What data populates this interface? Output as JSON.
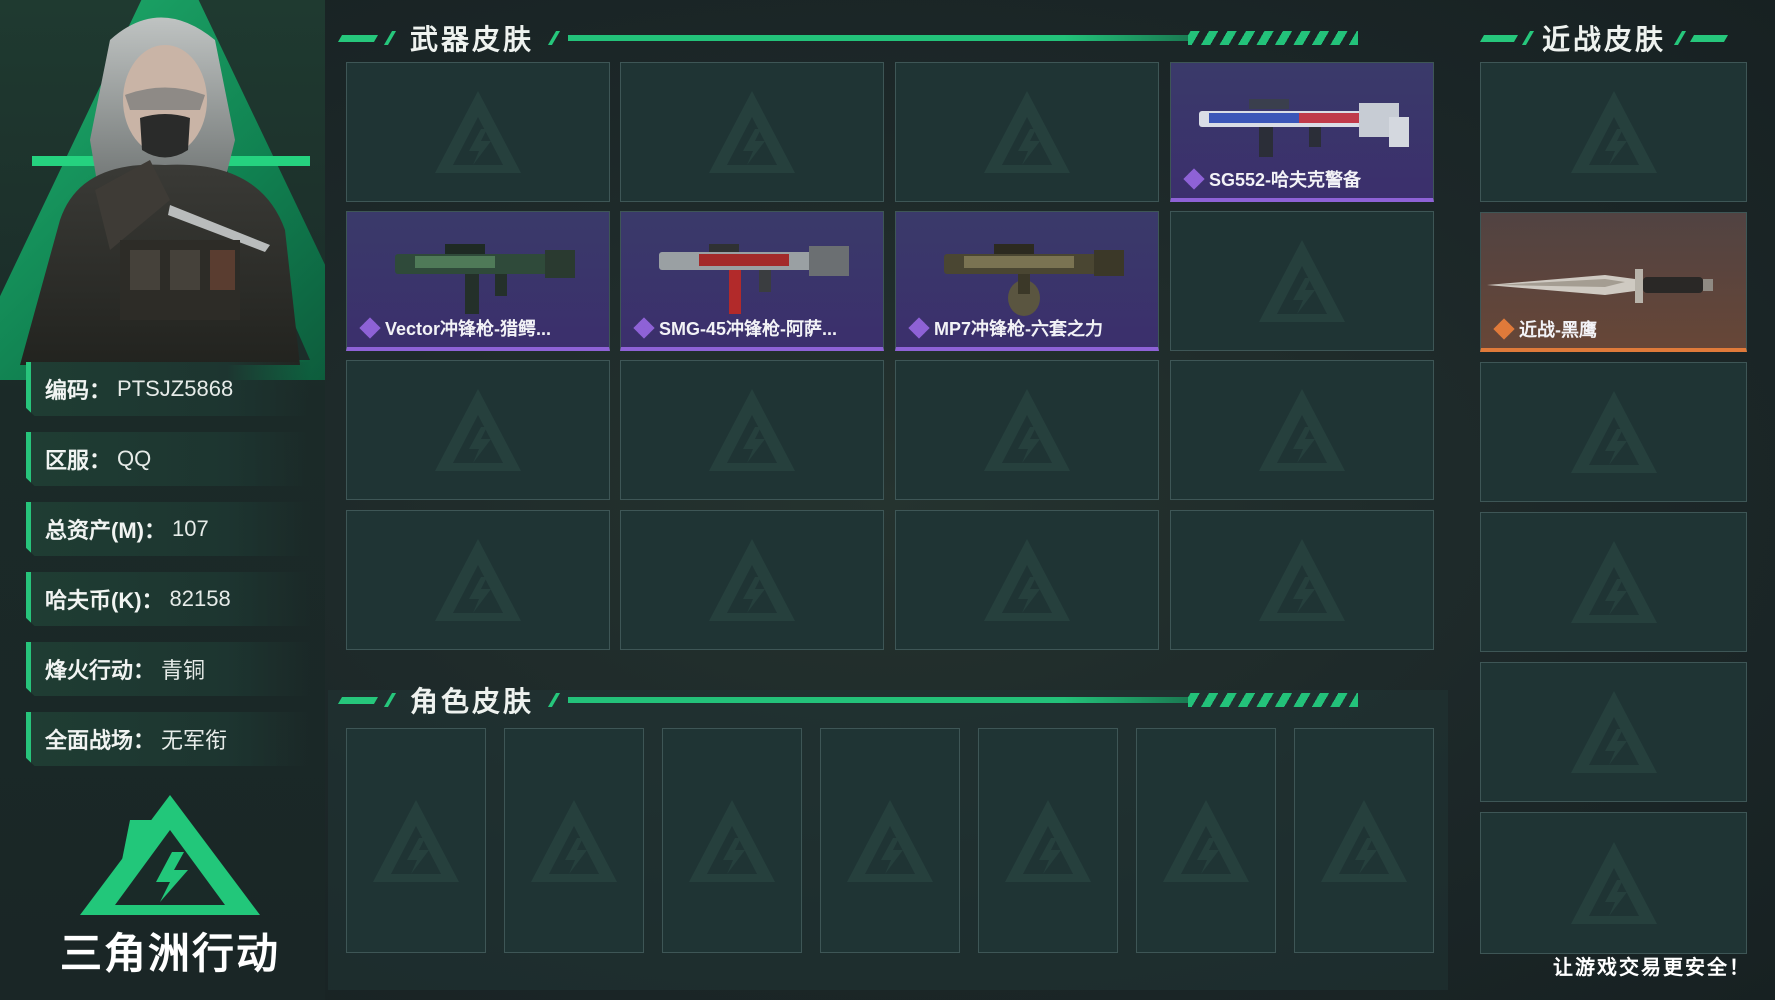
{
  "profile": {
    "fields": [
      {
        "key": "编码：",
        "value": "PTSJZ5868"
      },
      {
        "key": "区服：",
        "value": "QQ"
      },
      {
        "key": "总资产(M)：",
        "value": "107"
      },
      {
        "key": "哈夫币(K)：",
        "value": "82158"
      },
      {
        "key": "烽火行动：",
        "value": "青铜"
      },
      {
        "key": "全面战场：",
        "value": "无军衔"
      }
    ]
  },
  "logo": {
    "text": "三角洲行动"
  },
  "sections": {
    "weapon_skins": "武器皮肤",
    "melee_skins": "近战皮肤",
    "role_skins": "角色皮肤"
  },
  "weapon_cards": [
    {
      "label": ""
    },
    {
      "label": ""
    },
    {
      "label": ""
    },
    {
      "label": "SG552-哈夫克警备",
      "rarity": "purple"
    },
    {
      "label": "Vector冲锋枪-猎鳄...",
      "rarity": "purple"
    },
    {
      "label": "SMG-45冲锋枪-阿萨...",
      "rarity": "purple"
    },
    {
      "label": "MP7冲锋枪-六套之力",
      "rarity": "purple"
    },
    {
      "label": ""
    },
    {
      "label": ""
    },
    {
      "label": ""
    },
    {
      "label": ""
    },
    {
      "label": ""
    },
    {
      "label": ""
    },
    {
      "label": ""
    },
    {
      "label": ""
    },
    {
      "label": ""
    }
  ],
  "melee_cards": [
    {
      "label": ""
    },
    {
      "label": "近战-黑鹰",
      "rarity": "orange"
    },
    {
      "label": ""
    },
    {
      "label": ""
    },
    {
      "label": ""
    },
    {
      "label": ""
    }
  ],
  "footer": {
    "note": "让游戏交易更安全！"
  },
  "colors": {
    "accent": "#26c77c",
    "purple": "#8e62d6",
    "orange": "#e07a3a"
  }
}
